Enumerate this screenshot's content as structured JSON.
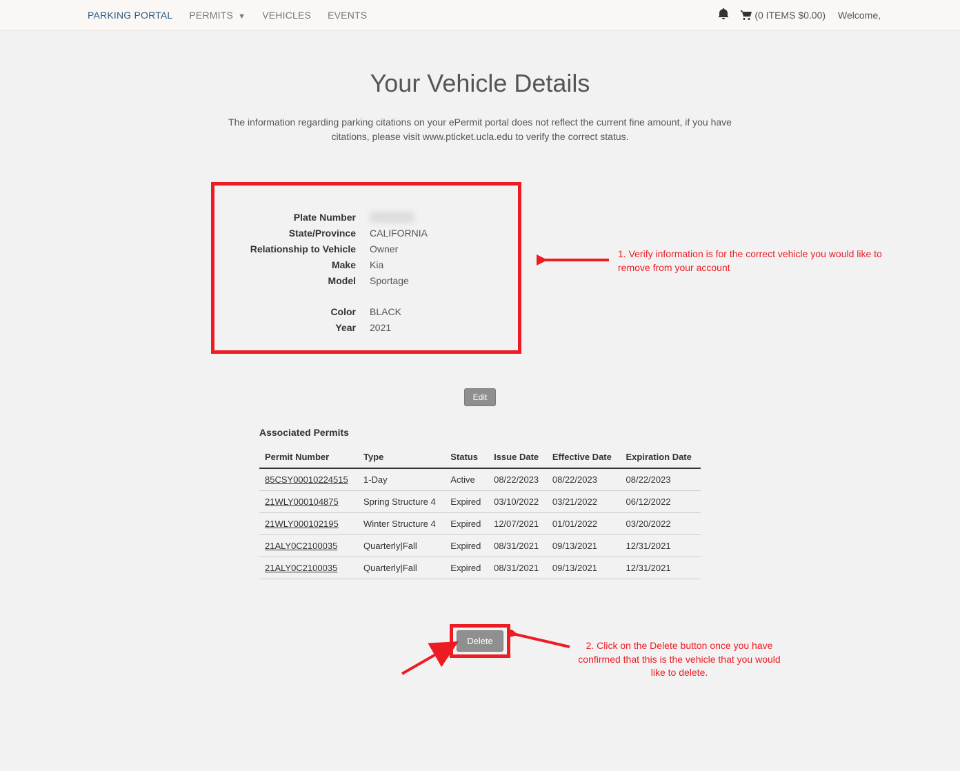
{
  "nav": {
    "portal": "PARKING PORTAL",
    "permits": "PERMITS",
    "vehicles": "VEHICLES",
    "events": "EVENTS",
    "cart": "(0 ITEMS $0.00)",
    "welcome": "Welcome,"
  },
  "page": {
    "title": "Your Vehicle Details",
    "subtitle": "The information regarding parking citations on your ePermit portal does not reflect the current fine amount, if you have citations, please visit www.pticket.ucla.edu to verify the correct status."
  },
  "details": {
    "labels": {
      "plate": "Plate Number",
      "state": "State/Province",
      "relationship": "Relationship to Vehicle",
      "make": "Make",
      "model": "Model",
      "color": "Color",
      "year": "Year"
    },
    "values": {
      "plate": "",
      "state": "CALIFORNIA",
      "relationship": "Owner",
      "make": "Kia",
      "model": "Sportage",
      "color": "BLACK",
      "year": "2021"
    }
  },
  "buttons": {
    "edit": "Edit",
    "delete": "Delete"
  },
  "permits": {
    "heading": "Associated Permits",
    "headers": {
      "permit_number": "Permit Number",
      "type": "Type",
      "status": "Status",
      "issue_date": "Issue Date",
      "effective_date": "Effective Date",
      "expiration_date": "Expiration Date"
    },
    "rows": [
      {
        "permit_number": "85CSY00010224515",
        "type": "1-Day",
        "status": "Active",
        "issue_date": "08/22/2023",
        "effective_date": "08/22/2023",
        "expiration_date": "08/22/2023"
      },
      {
        "permit_number": "21WLY000104875",
        "type": "Spring Structure 4",
        "status": "Expired",
        "issue_date": "03/10/2022",
        "effective_date": "03/21/2022",
        "expiration_date": "06/12/2022"
      },
      {
        "permit_number": "21WLY000102195",
        "type": "Winter Structure 4",
        "status": "Expired",
        "issue_date": "12/07/2021",
        "effective_date": "01/01/2022",
        "expiration_date": "03/20/2022"
      },
      {
        "permit_number": "21ALY0C2100035",
        "type": "Quarterly|Fall",
        "status": "Expired",
        "issue_date": "08/31/2021",
        "effective_date": "09/13/2021",
        "expiration_date": "12/31/2021"
      },
      {
        "permit_number": "21ALY0C2100035",
        "type": "Quarterly|Fall",
        "status": "Expired",
        "issue_date": "08/31/2021",
        "effective_date": "09/13/2021",
        "expiration_date": "12/31/2021"
      }
    ]
  },
  "annotations": {
    "step1": "1. Verify information is for the correct vehicle you would like to remove from your account",
    "step2": "2. Click on the Delete button once you have confirmed that this is the vehicle that you would like to delete."
  }
}
